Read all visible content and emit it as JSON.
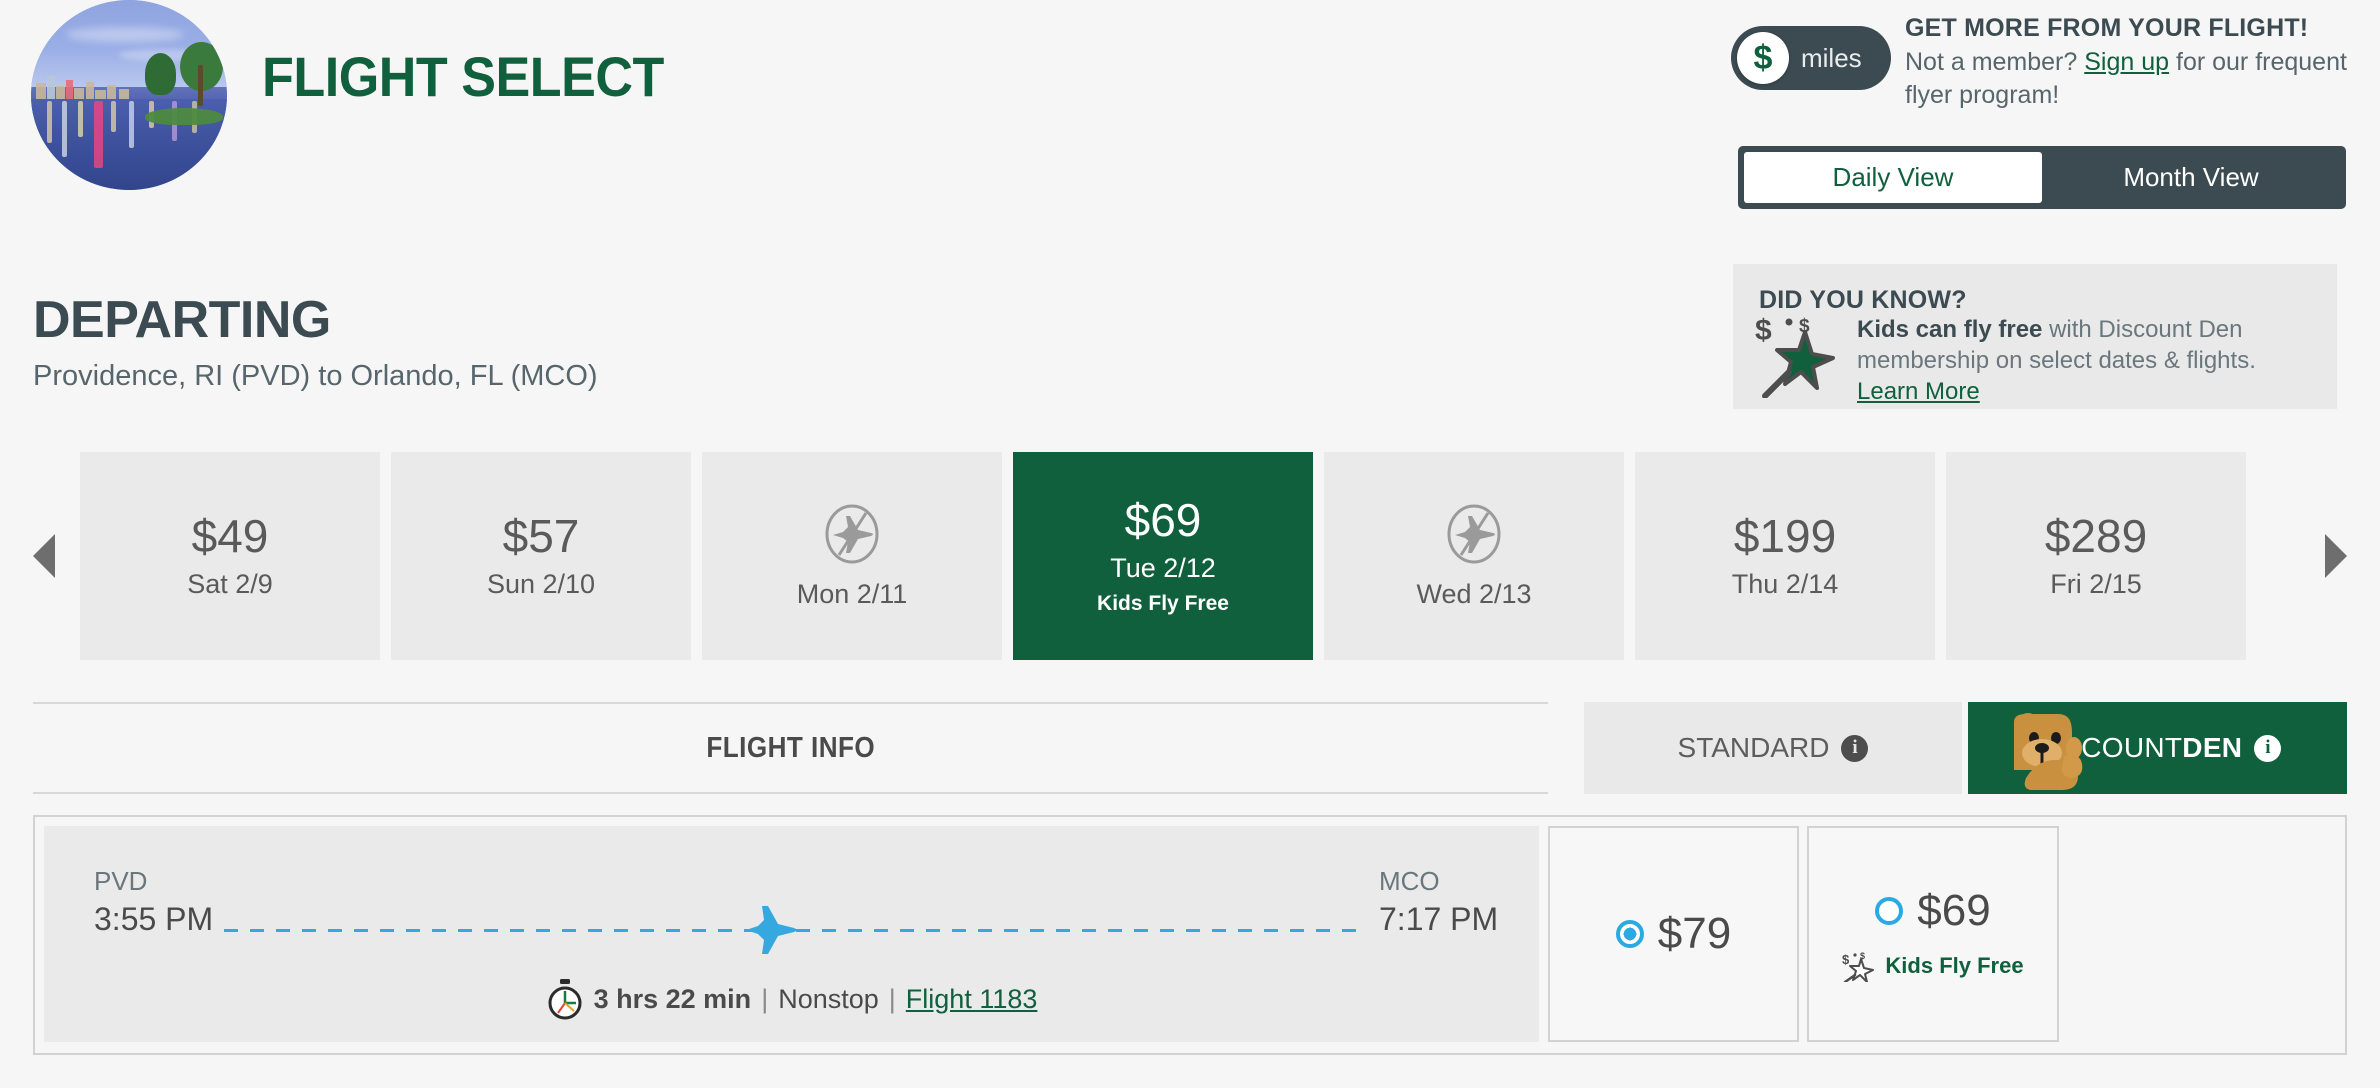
{
  "header": {
    "title": "FLIGHT SELECT",
    "logo_alt": "orlando-skyline-thumbnail",
    "miles_badge": {
      "symbol": "$",
      "label": "miles"
    },
    "promo_heading": "GET MORE FROM YOUR FLIGHT!",
    "promo_prefix": "Not a member? ",
    "promo_link": "Sign up",
    "promo_suffix": " for our frequent flyer program!"
  },
  "view_toggle": {
    "daily_label": "Daily View",
    "month_label": "Month View",
    "active": "Daily View"
  },
  "did_you_know": {
    "title": "DID YOU KNOW?",
    "body_bold": "Kids can fly free",
    "body_rest": " with Discount Den membership on select dates & flights.",
    "link": "Learn More",
    "icon": "magic-wand-star-icon"
  },
  "departing": {
    "heading": "DEPARTING",
    "route": "Providence, RI (PVD) to Orlando, FL (MCO)"
  },
  "date_strip": {
    "prev_icon": "chevron-left-icon",
    "next_icon": "chevron-right-icon",
    "tiles": [
      {
        "price": "$49",
        "date": "Sat 2/9",
        "available": true,
        "selected": false,
        "badge": ""
      },
      {
        "price": "$57",
        "date": "Sun 2/10",
        "available": true,
        "selected": false,
        "badge": ""
      },
      {
        "price": "",
        "date": "Mon 2/11",
        "available": false,
        "selected": false,
        "badge": ""
      },
      {
        "price": "$69",
        "date": "Tue 2/12",
        "available": true,
        "selected": true,
        "badge": "Kids Fly Free"
      },
      {
        "price": "",
        "date": "Wed 2/13",
        "available": false,
        "selected": false,
        "badge": ""
      },
      {
        "price": "$199",
        "date": "Thu 2/14",
        "available": true,
        "selected": false,
        "badge": ""
      },
      {
        "price": "$289",
        "date": "Fri 2/15",
        "available": true,
        "selected": false,
        "badge": ""
      }
    ]
  },
  "tabs": {
    "flight_info": "FLIGHT INFO",
    "standard": "STANDARD",
    "den_prefix": "DISCOUNT",
    "den_suffix": "DEN",
    "info_icon": "info-icon"
  },
  "flight": {
    "origin_code": "PVD",
    "origin_time": "3:55 PM",
    "dest_code": "MCO",
    "dest_time": "7:17 PM",
    "duration": "3 hrs 22 min",
    "separator": "|",
    "stops": "Nonstop",
    "flight_number": "Flight 1183",
    "plane_icon": "airplane-icon",
    "clock_icon": "stopwatch-icon"
  },
  "fares": [
    {
      "id": "standard",
      "price": "$79",
      "selected": true,
      "badge": ""
    },
    {
      "id": "discount_den",
      "price": "$69",
      "selected": false,
      "badge": "Kids Fly Free"
    }
  ],
  "colors": {
    "brand_green": "#10603d",
    "slate": "#3b4b51",
    "accent_blue": "#2aaae2",
    "tile_gray": "#eaeaea",
    "page_bg": "#f6f6f6"
  }
}
